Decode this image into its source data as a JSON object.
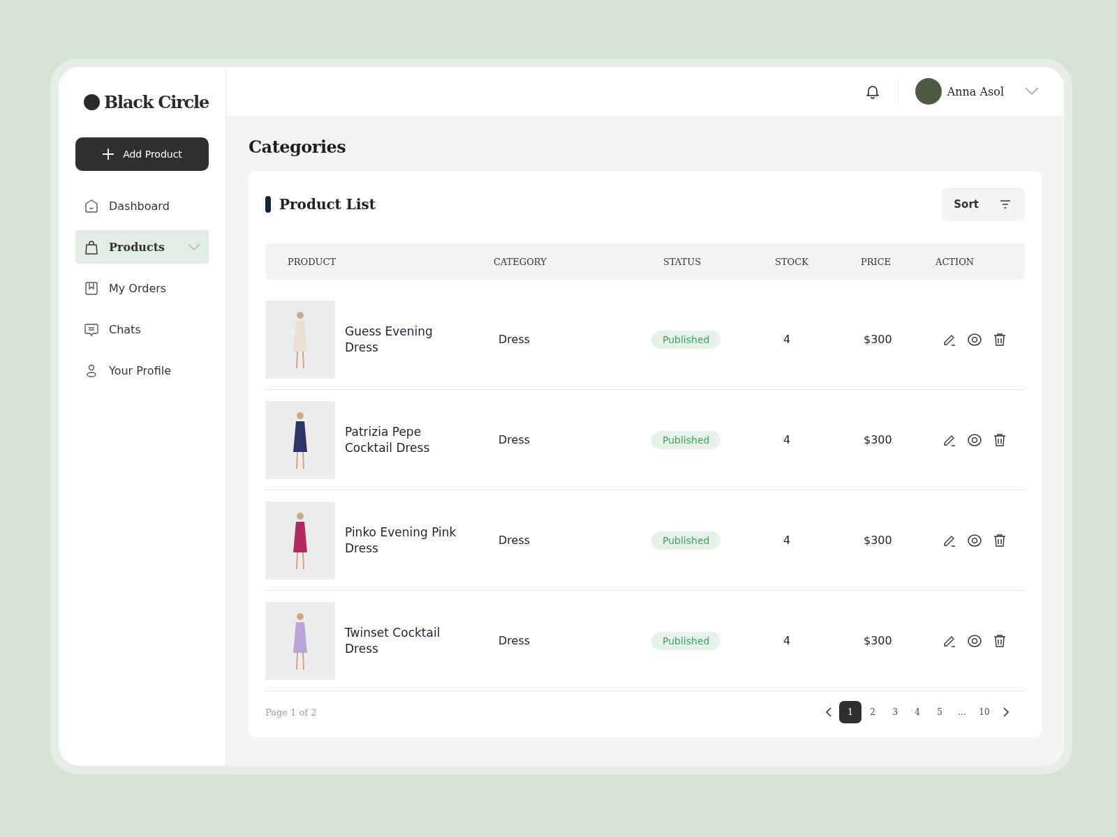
{
  "brand": {
    "name": "Black Circle"
  },
  "add_button": {
    "label": "Add Product"
  },
  "sidebar": {
    "items": [
      {
        "label": "Dashboard",
        "selected": false,
        "expandable": false
      },
      {
        "label": "Products",
        "selected": true,
        "expandable": true
      },
      {
        "label": "My Orders",
        "selected": false,
        "expandable": false
      },
      {
        "label": "Chats",
        "selected": false,
        "expandable": false
      },
      {
        "label": "Your Profile",
        "selected": false,
        "expandable": false
      }
    ]
  },
  "header": {
    "user_name": "Anna Asol"
  },
  "page_title": "Categories",
  "card": {
    "title": "Product List",
    "sort_label": "Sort"
  },
  "table": {
    "columns": [
      "PRODUCT",
      "CATEGORY",
      "STATUS",
      "STOCK",
      "PRICE",
      "ACTION"
    ],
    "rows": [
      {
        "name": "Guess Evening Dress",
        "category": "Dress",
        "status": "Published",
        "stock": "4",
        "price": "$300",
        "color": "#e8e0d2"
      },
      {
        "name": "Patrizia Pepe Cocktail Dress",
        "category": "Dress",
        "status": "Published",
        "stock": "4",
        "price": "$300",
        "color": "#2c3566"
      },
      {
        "name": "Pinko Evening Pink Dress",
        "category": "Dress",
        "status": "Published",
        "stock": "4",
        "price": "$300",
        "color": "#b22a5c"
      },
      {
        "name": "Twinset Cocktail Dress",
        "category": "Dress",
        "status": "Published",
        "stock": "4",
        "price": "$300",
        "color": "#b9a4d8"
      }
    ]
  },
  "pagination": {
    "summary": "Page 1 of 2",
    "pages": [
      {
        "label": "1",
        "selected": true
      },
      {
        "label": "2",
        "selected": false
      },
      {
        "label": "3",
        "selected": false
      },
      {
        "label": "4",
        "selected": false
      },
      {
        "label": "5",
        "selected": false
      },
      {
        "label": "...",
        "selected": false
      },
      {
        "label": "10",
        "selected": false
      }
    ]
  }
}
